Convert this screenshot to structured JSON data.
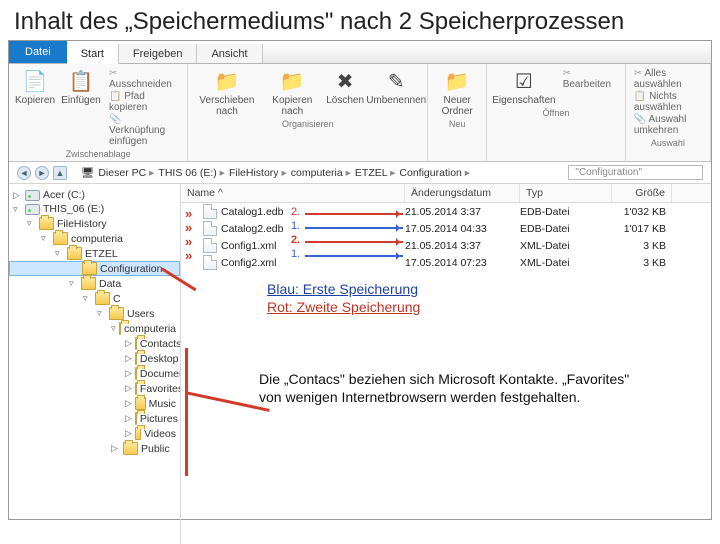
{
  "slide_title": "Inhalt des „Speichermediums\" nach 2 Speicherprozessen",
  "tabs": {
    "file": "Datei",
    "start": "Start",
    "share": "Freigeben",
    "view": "Ansicht"
  },
  "ribbon": {
    "copy": "Kopieren",
    "paste": "Einfügen",
    "cut": "Ausschneiden",
    "copypath": "Pfad kopieren",
    "pasteshort": "Verknüpfung einfügen",
    "clipboard_cap": "Zwischenablage",
    "moveto": "Verschieben nach",
    "copyto": "Kopieren nach",
    "delete": "Löschen",
    "rename": "Umbenennen",
    "organize_cap": "Organisieren",
    "newfolder": "Neuer Ordner",
    "new_cap": "Neu",
    "properties": "Eigenschaften",
    "open_cap": "Öffnen",
    "edit": "Bearbeiten",
    "selall": "Alles auswählen",
    "selnone": "Nichts auswählen",
    "selinv": "Auswahl umkehren",
    "select_cap": "Auswahl"
  },
  "crumbs": [
    "Dieser PC",
    "THIS 06 (E:)",
    "FileHistory",
    "computeria",
    "ETZEL",
    "Configuration"
  ],
  "search_placeholder": "\"Configuration\"",
  "cols": {
    "name": "Name ^",
    "date": "Änderungsdatum",
    "type": "Typ",
    "size": "Größe"
  },
  "tree": {
    "root1": "Acer (C:)",
    "root2": "THIS_06 (E:)",
    "n1": "FileHistory",
    "n2": "computeria",
    "n3": "ETZEL",
    "n4": "Configuration",
    "n5": "Data",
    "n6": "C",
    "n7": "Users",
    "n8": "computeria",
    "leafs": [
      "Contacts",
      "Desktop",
      "Documents",
      "Favorites",
      "Music",
      "Pictures",
      "Videos"
    ],
    "n9": "Public"
  },
  "files": [
    {
      "name": "Catalog1.edb",
      "date": "21.05.2014 3:37",
      "type": "EDB-Datei",
      "size": "1'032 KB",
      "mark": "2.",
      "col": "red"
    },
    {
      "name": "Catalog2.edb",
      "date": "17.05.2014 04:33",
      "type": "EDB-Datei",
      "size": "1'017 KB",
      "mark": "1.",
      "col": "blue"
    },
    {
      "name": "Config1.xml",
      "date": "21.05.2014 3:37",
      "type": "XML-Datei",
      "size": "3 KB",
      "mark": "2.",
      "col": "red"
    },
    {
      "name": "Config2.xml",
      "date": "17.05.2014 07:23",
      "type": "XML-Datei",
      "size": "3 KB",
      "mark": "1.",
      "col": "blue"
    }
  ],
  "legend": {
    "l1": "Blau: Erste Speicherung",
    "l2": "Rot: Zweite Speicherung"
  },
  "note": "Die „Contacs\" beziehen sich Microsoft Kontakte. „Favorites\" von wenigen Internetbrowsern werden festgehalten."
}
